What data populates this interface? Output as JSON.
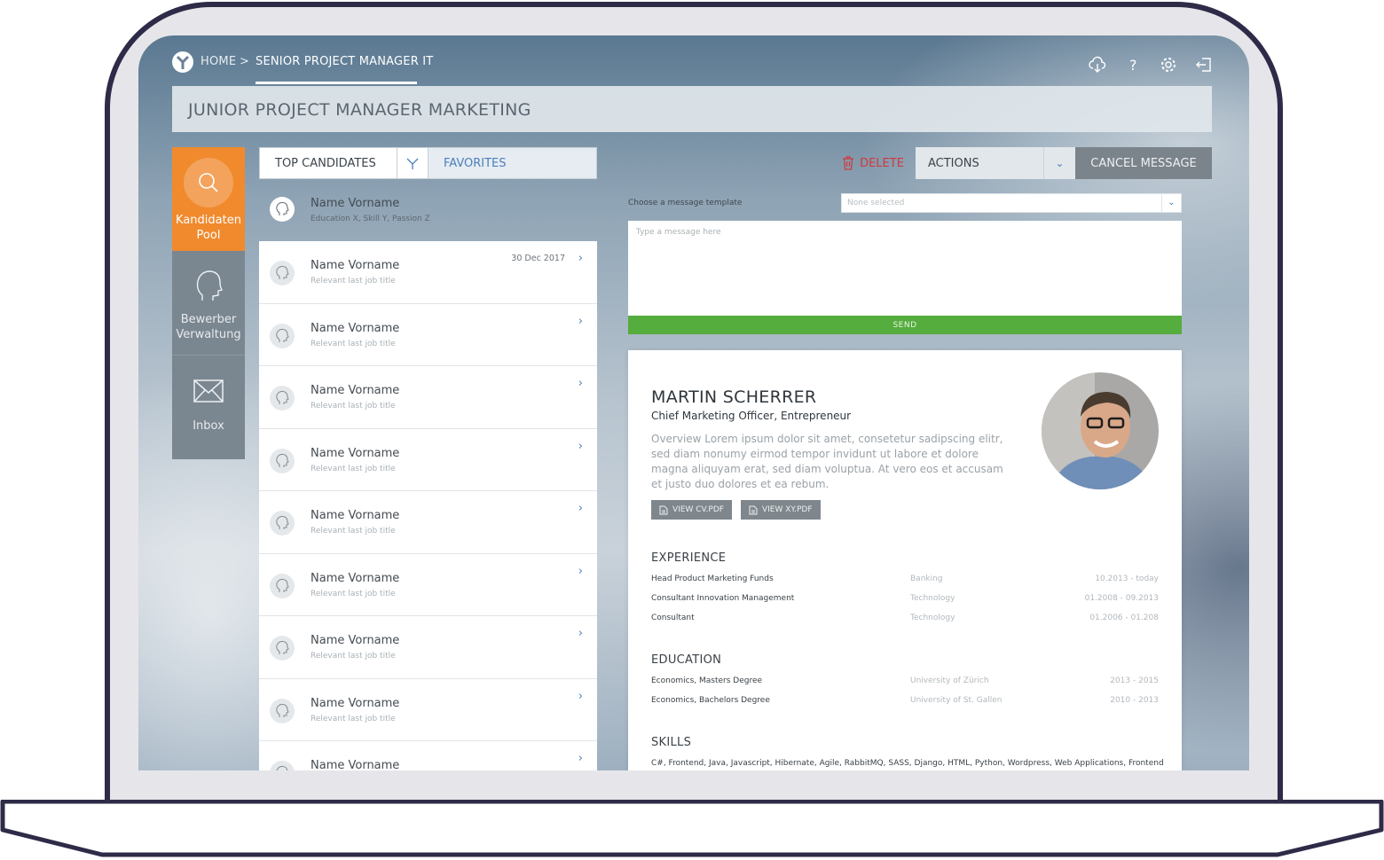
{
  "breadcrumb": {
    "home": "HOME",
    "separator": ">",
    "current": "SENIOR PROJECT MANAGER IT"
  },
  "top_icons": [
    "cloud-download-icon",
    "help-icon",
    "settings-gear-icon",
    "logout-icon"
  ],
  "page_title": "JUNIOR PROJECT MANAGER MARKETING",
  "sidebar": {
    "items": [
      {
        "label_line1": "Kandidaten",
        "label_line2": "Pool",
        "icon": "search-icon",
        "active": true
      },
      {
        "label_line1": "Bewerber",
        "label_line2": "Verwaltung",
        "icon": "head-profile-icon",
        "active": false
      },
      {
        "label_line1": "Inbox",
        "label_line2": "",
        "icon": "envelope-icon",
        "active": false
      }
    ]
  },
  "candidate_list": {
    "tab_top": "TOP CANDIDATES",
    "tab_favorites": "FAVORITES",
    "featured": {
      "name": "Name Vorname",
      "sub": "Education X, Skill Y, Passion Z"
    },
    "rows": [
      {
        "name": "Name Vorname",
        "sub": "Relevant last job title",
        "date": "30 Dec 2017"
      },
      {
        "name": "Name Vorname",
        "sub": "Relevant last job title",
        "date": ""
      },
      {
        "name": "Name Vorname",
        "sub": "Relevant last job title",
        "date": ""
      },
      {
        "name": "Name Vorname",
        "sub": "Relevant last job title",
        "date": ""
      },
      {
        "name": "Name Vorname",
        "sub": "Relevant last job title",
        "date": ""
      },
      {
        "name": "Name Vorname",
        "sub": "Relevant last job title",
        "date": ""
      },
      {
        "name": "Name Vorname",
        "sub": "Relevant last job title",
        "date": ""
      },
      {
        "name": "Name Vorname",
        "sub": "Relevant last job title",
        "date": ""
      },
      {
        "name": "Name Vorname",
        "sub": "",
        "date": ""
      }
    ]
  },
  "action_bar": {
    "delete_label": "DELETE",
    "actions_label": "ACTIONS",
    "cancel_label": "CANCEL MESSAGE"
  },
  "composer": {
    "template_label": "Choose a message template",
    "template_placeholder": "None selected",
    "message_placeholder": "Type a message here",
    "send_label": "SEND"
  },
  "profile": {
    "name": "MARTIN SCHERRER",
    "title": "Chief Marketing Officer, Entrepreneur",
    "overview": "Overview Lorem ipsum dolor sit amet, consetetur sadipscing elitr, sed diam nonumy eirmod tempor invidunt ut labore et dolore magna aliquyam erat, sed diam voluptua. At vero eos et accusam et justo duo dolores et ea rebum.",
    "btn_cv": "VIEW CV.PDF",
    "btn_xy": "VIEW XY.PDF",
    "experience_title": "EXPERIENCE",
    "experience": [
      {
        "role": "Head Product Marketing Funds",
        "field": "Banking",
        "period": "10.2013 - today"
      },
      {
        "role": "Consultant Innovation Management",
        "field": "Technology",
        "period": "01.2008 - 09.2013"
      },
      {
        "role": "Consultant",
        "field": "Technology",
        "period": "01.2006 - 01.208"
      }
    ],
    "education_title": "EDUCATION",
    "education": [
      {
        "degree": "Economics, Masters Degree",
        "school": "University of Zürich",
        "period": "2013 - 2015"
      },
      {
        "degree": "Economics, Bachelors Degree",
        "school": "University of St. Gallen",
        "period": "2010 - 2013"
      }
    ],
    "skills_title": "SKILLS",
    "skills": "C#, Frontend, Java, Javascript, Hibernate, Agile, RabbitMQ, SASS, Django, HTML, Python, Wordpress, Web Applications, Frontend"
  },
  "colors": {
    "accent_orange": "#f08a2d",
    "link_blue": "#4a7fbb",
    "send_green": "#55ad3d",
    "delete_red": "#d0393e",
    "frame_navy": "#2d2b47"
  }
}
